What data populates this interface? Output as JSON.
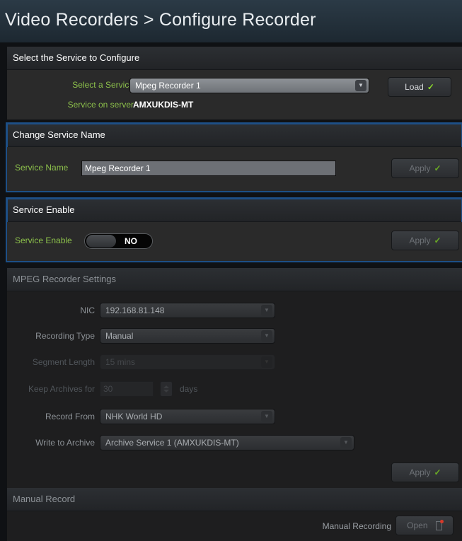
{
  "header": {
    "title": "Video Recorders  > Configure Recorder"
  },
  "select_service": {
    "heading": "Select the Service to Configure",
    "service_label": "Select a Service",
    "service_value": "Mpeg Recorder 1",
    "server_label": "Service on server",
    "server_value": "AMXUKDIS-MT",
    "load_label": "Load"
  },
  "change_name": {
    "heading": "Change Service Name",
    "name_label": "Service Name",
    "name_value": "Mpeg Recorder 1",
    "apply_label": "Apply"
  },
  "service_enable": {
    "heading": "Service Enable",
    "enable_label": "Service Enable",
    "toggle_state": "NO",
    "apply_label": "Apply"
  },
  "mpeg_settings": {
    "heading": "MPEG Recorder Settings",
    "nic_label": "NIC",
    "nic_value": "192.168.81.148",
    "recording_type_label": "Recording Type",
    "recording_type_value": "Manual",
    "segment_length_label": "Segment Length",
    "segment_length_value": "15 mins",
    "keep_archives_label": "Keep Archives for",
    "keep_archives_value": "30",
    "keep_archives_unit": "days",
    "record_from_label": "Record From",
    "record_from_value": "NHK World HD",
    "write_archive_label": "Write to Archive",
    "write_archive_value": "Archive Service 1  (AMXUKDIS-MT)",
    "apply_label": "Apply"
  },
  "manual_record": {
    "heading": "Manual Record",
    "recording_label": "Manual Recording",
    "open_label": "Open"
  },
  "colors": {
    "accent_green": "#8cc04b",
    "check_green": "#8ddc2c",
    "focus_blue": "#1d4f86"
  },
  "icons": {
    "check": "check-icon",
    "dropdown": "chevron-down-icon",
    "record": "record-icon"
  }
}
